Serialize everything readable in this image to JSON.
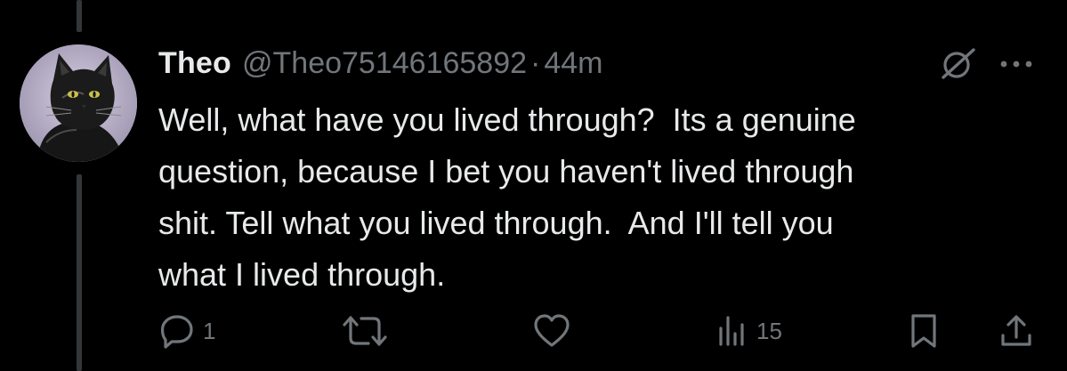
{
  "author": {
    "display_name": "Theo",
    "handle": "@Theo75146165892",
    "separator": "·",
    "time": "44m",
    "avatar_icon": "black-cat-avatar"
  },
  "tweet": {
    "text": "Well, what have you lived through?  Its a genuine\nquestion, because I bet you haven't lived through\nshit. Tell what you lived through.  And I'll tell you\nwhat I lived through."
  },
  "icons": {
    "grok": "grok-icon",
    "more": "more-icon"
  },
  "actions": {
    "reply_count": "1",
    "retweet_count": "",
    "like_count": "",
    "views_count": "15"
  },
  "colors": {
    "background": "#000000",
    "primary_text": "#e7e9ea",
    "secondary_text": "#71767b",
    "thread_line": "#333639"
  }
}
